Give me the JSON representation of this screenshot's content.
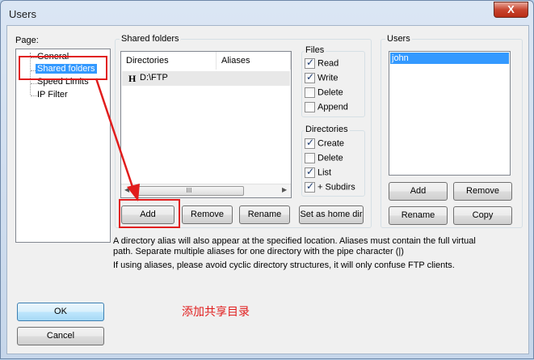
{
  "window": {
    "title": "Users",
    "close_label": "X"
  },
  "page_panel": {
    "label": "Page:",
    "items": [
      "General",
      "Shared folders",
      "Speed Limits",
      "IP Filter"
    ]
  },
  "shared": {
    "title": "Shared folders",
    "columns": [
      "Directories",
      "Aliases"
    ],
    "rows": [
      {
        "marker": "H",
        "path": "D:\\FTP"
      }
    ],
    "scroll_thumb": "III",
    "add_label": "Add",
    "remove_label": "Remove",
    "rename_label": "Rename",
    "set_home_label": "Set as home dir"
  },
  "files": {
    "title": "Files",
    "read": "Read",
    "write": "Write",
    "delete": "Delete",
    "append": "Append"
  },
  "dirs": {
    "title": "Directories",
    "create": "Create",
    "delete": "Delete",
    "list": "List",
    "subdirs": "+ Subdirs"
  },
  "users": {
    "title": "Users",
    "list": [
      "john"
    ],
    "add_label": "Add",
    "remove_label": "Remove",
    "rename_label": "Rename",
    "copy_label": "Copy"
  },
  "info": {
    "line1": "A directory alias will also appear at the specified location. Aliases must contain the full virtual",
    "line2": "path. Separate multiple aliases for one directory with the pipe character (|)",
    "line3": "If using aliases, please avoid cyclic directory structures, it will only confuse FTP clients."
  },
  "buttons": {
    "ok": "OK",
    "cancel": "Cancel"
  },
  "annotation": {
    "text": "添加共享目录",
    "color": "#e11d1d"
  }
}
